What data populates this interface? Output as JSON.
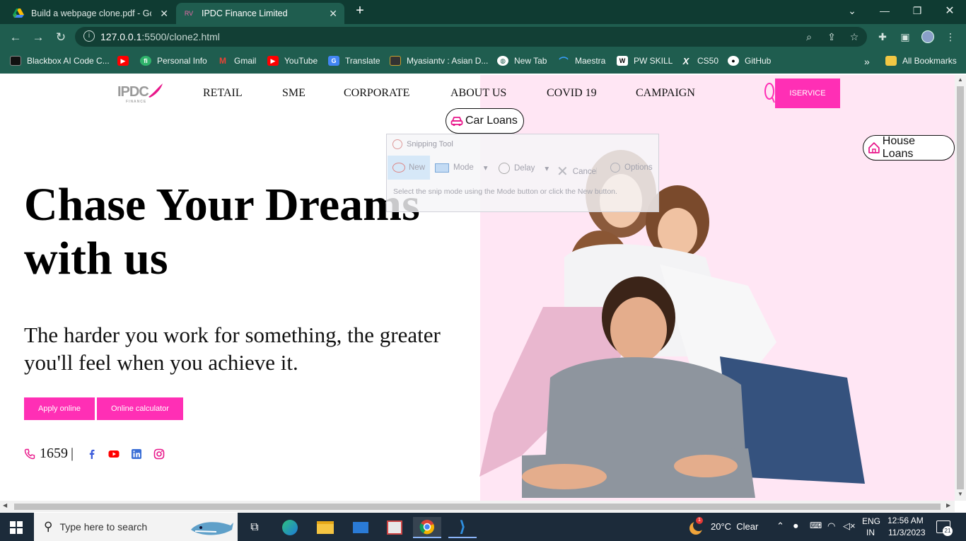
{
  "browser": {
    "tabs": [
      {
        "title": "Build a webpage clone.pdf - Goo",
        "active": false
      },
      {
        "title": "IPDC Finance Limited",
        "active": true
      }
    ],
    "new_tab": "+",
    "address": {
      "host": "127.0.0.1",
      "rest": ":5500/clone2.html"
    },
    "bookmarks": [
      {
        "label": "Blackbox AI Code C...",
        "icon": "blackbox-icon",
        "color": "#111111"
      },
      {
        "label": "",
        "icon": "youtube-icon",
        "color": "#ff0000"
      },
      {
        "label": "Personal Info",
        "icon": "fi-icon",
        "color": "#2fb36b"
      },
      {
        "label": "Gmail",
        "icon": "gmail-icon",
        "color": "#ea4335"
      },
      {
        "label": "YouTube",
        "icon": "youtube-icon",
        "color": "#ff0000"
      },
      {
        "label": "Translate",
        "icon": "translate-icon",
        "color": "#4285f4"
      },
      {
        "label": "Myasiantv : Asian D...",
        "icon": "myasiantv-icon",
        "color": "#222222"
      },
      {
        "label": "New Tab",
        "icon": "globe-icon",
        "color": "#ffffff"
      },
      {
        "label": "Maestra",
        "icon": "maestra-icon",
        "color": "#3aa0ff"
      },
      {
        "label": "PW SKILL",
        "icon": "pw-icon",
        "color": "#ffffff"
      },
      {
        "label": "CS50",
        "icon": "cs50-icon",
        "color": "#000000"
      },
      {
        "label": "GitHub",
        "icon": "github-icon",
        "color": "#333333"
      }
    ],
    "more_bookmarks": "»",
    "all_bookmarks": "All Bookmarks"
  },
  "page": {
    "logo": {
      "text": "IPDC",
      "subtext": "FINANCE"
    },
    "menu": [
      "RETAIL",
      "SME",
      "CORPORATE",
      "ABOUT US",
      "COVID 19",
      "CAMPAIGN"
    ],
    "iservice": "ISERVICE",
    "car_loans": "Car Loans",
    "house_loans": "House Loans",
    "hero_title": "Chase Your Dreams with us",
    "hero_subtitle": "The harder you work for something, the greater you'll feel when you achieve it.",
    "buttons": {
      "apply": "Apply online",
      "calculator": "Online calculator"
    },
    "hotline": "1659",
    "separator": "|",
    "accent_color": "#ff2fb5"
  },
  "snipping_tool": {
    "title": "Snipping Tool",
    "new": "New",
    "mode": "Mode",
    "delay": "Delay",
    "cancel": "Cancel",
    "options": "Options",
    "message": "Select the snip mode using the Mode button or click the New button."
  },
  "taskbar": {
    "search_placeholder": "Type here to search",
    "weather": "20°C  Clear",
    "weather_badge": "1",
    "language": {
      "top": "ENG",
      "bottom": "IN"
    },
    "time": "12:56 AM",
    "date": "11/3/2023",
    "notifications": "21"
  }
}
